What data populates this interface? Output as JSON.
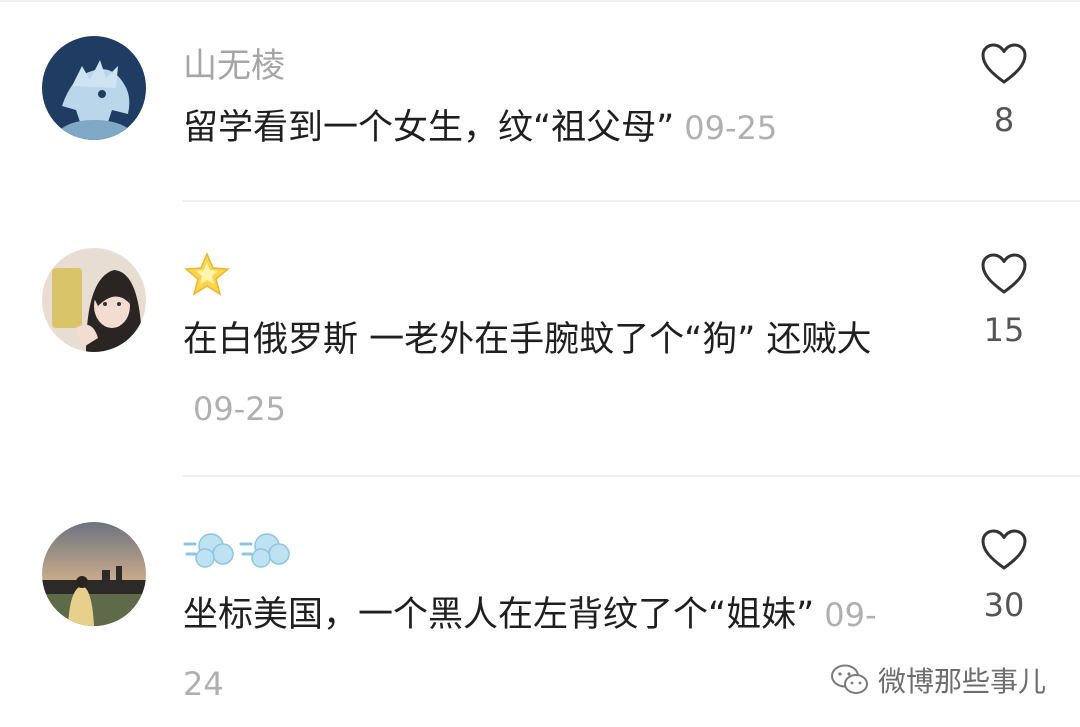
{
  "comments": [
    {
      "username": "山无棱",
      "text": "留学看到一个女生，纹“祖父母”",
      "date": "09-25",
      "likes": "8",
      "avatar": "anime-character-avatar"
    },
    {
      "username": "",
      "badge": "star-emoji",
      "text": "在白俄罗斯 一老外在手腕蚊了个“狗” 还贼大",
      "date": "09-25",
      "likes": "15",
      "avatar": "girl-selfie-avatar"
    },
    {
      "username": "",
      "badge": "dash-emoji-pair",
      "text": "坐标美国，一个黑人在左背纹了个“姐妹”",
      "date": "09-24",
      "likes": "30",
      "avatar": "sunset-skyline-avatar"
    }
  ],
  "watermark": {
    "text": "微博那些事儿",
    "icon": "wechat-icon"
  },
  "colors": {
    "text": "#1f1f1f",
    "meta": "#a6a6a6",
    "divider": "#efefef"
  }
}
